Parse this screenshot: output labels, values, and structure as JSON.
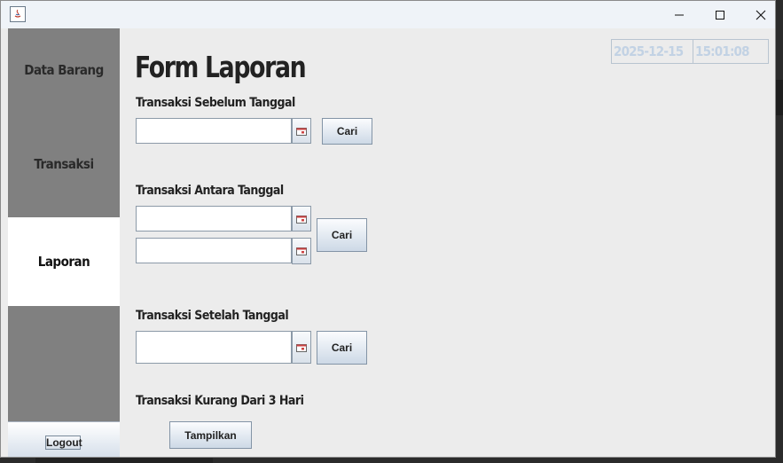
{
  "window": {
    "icon": "java-icon"
  },
  "controls": {
    "minimize": "minimize-icon",
    "maximize": "maximize-icon",
    "close": "close-icon"
  },
  "sidebar": {
    "items": [
      {
        "label": "Data Barang"
      },
      {
        "label": "Transaksi"
      },
      {
        "label": "Laporan",
        "active": true
      }
    ],
    "logout_label": "Logout"
  },
  "form": {
    "title": "Form Laporan",
    "clock": {
      "date": "2025-12-15",
      "time": "15:01:08"
    },
    "before": {
      "label": "Transaksi Sebelum Tanggal",
      "value": "",
      "button": "Cari"
    },
    "between": {
      "label": "Transaksi Antara Tanggal",
      "from_value": "",
      "to_value": "",
      "button": "Cari"
    },
    "after": {
      "label": "Transaksi Setelah Tanggal",
      "value": "",
      "button": "Cari"
    },
    "recent": {
      "label": "Transaksi Kurang Dari 3 Hari",
      "button": "Tampilkan"
    }
  },
  "colors": {
    "sidebar": "#808080",
    "active_item": "#ffffff",
    "background": "#ececec",
    "clock_text": "#c2d2e4"
  }
}
